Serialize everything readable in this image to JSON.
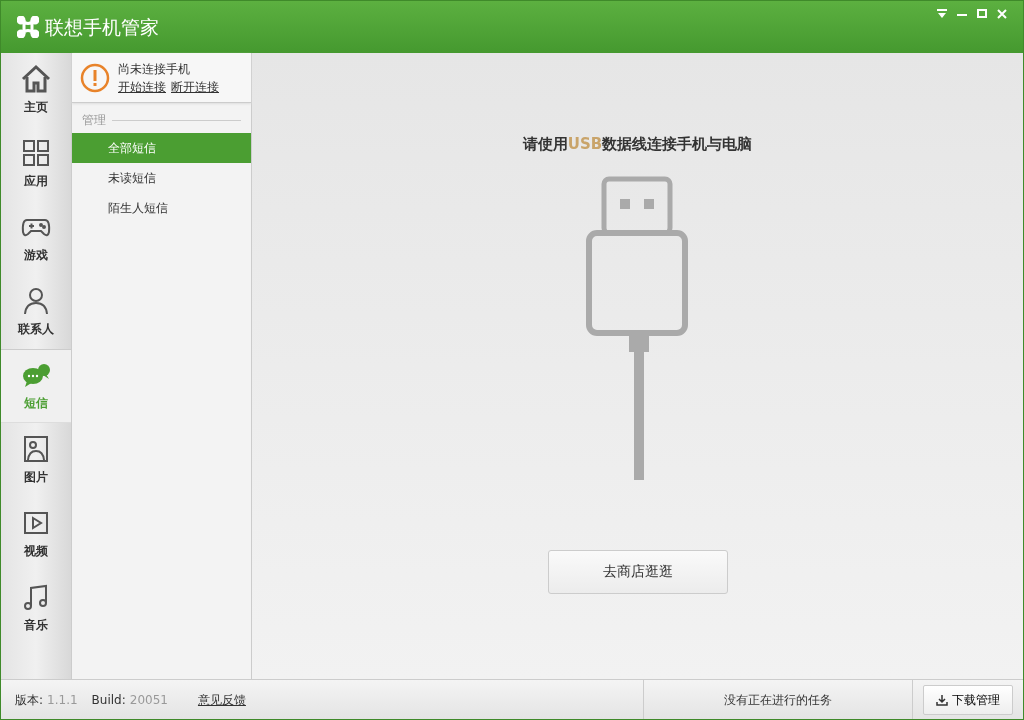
{
  "window": {
    "title": "联想手机管家"
  },
  "nav": [
    {
      "label": "主页",
      "kind": "home",
      "selected": false
    },
    {
      "label": "应用",
      "kind": "apps",
      "selected": false
    },
    {
      "label": "游戏",
      "kind": "game",
      "selected": false
    },
    {
      "label": "联系人",
      "kind": "contact",
      "selected": false
    },
    {
      "label": "短信",
      "kind": "sms",
      "selected": true
    },
    {
      "label": "图片",
      "kind": "picture",
      "selected": false
    },
    {
      "label": "视频",
      "kind": "video",
      "selected": false
    },
    {
      "label": "音乐",
      "kind": "music",
      "selected": false
    }
  ],
  "connection": {
    "status": "尚未连接手机",
    "links": [
      "开始连接",
      "断开连接"
    ]
  },
  "submenu": {
    "heading": "管理",
    "items": [
      {
        "label": "全部短信",
        "selected": true
      },
      {
        "label": "未读短信",
        "selected": false
      },
      {
        "label": "陌生人短信",
        "selected": false
      }
    ]
  },
  "main": {
    "instruction": {
      "before": "请使用",
      "highlight": "USB",
      "after": "数据线连接手机与电脑"
    },
    "button": "去商店逛逛"
  },
  "status_bar": {
    "version_label": "版本:",
    "version": "1.1.1",
    "build_label": "Build:",
    "build": "20051",
    "feedback": "意见反馈",
    "tasks": "没有正在进行的任务",
    "download_button": "下载管理"
  }
}
